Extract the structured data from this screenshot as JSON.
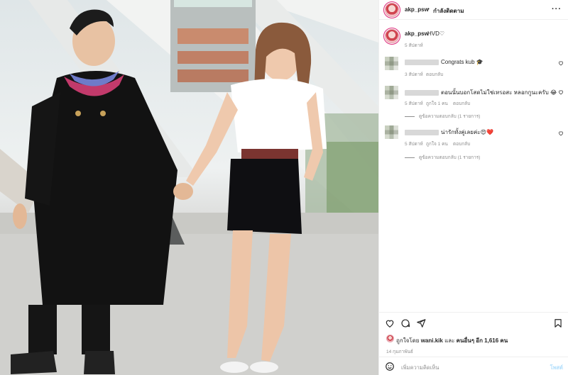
{
  "post": {
    "author": "akp_psw",
    "follow_status": "กำลังติดตาม",
    "caption": "HVD♡",
    "caption_time": "5 สัปดาห์"
  },
  "comments": [
    {
      "text": "Congrats kub 🎓",
      "time": "3 สัปดาห์",
      "reply_label": "ตอบกลับ"
    },
    {
      "text": "ตอนนั้นบอกโสดไม่ใช่เหรอสะ หลอกกูนะครับ 😂",
      "time": "5 สัปดาห์",
      "likes": "ถูกใจ 1 คน",
      "reply_label": "ตอบกลับ",
      "view_replies": "ดูข้อความตอบกลับ (1 รายการ)"
    },
    {
      "text": "น่ารักทั้งคู่เลยค่ะ😍❤️",
      "time": "5 สัปดาห์",
      "likes": "ถูกใจ 1 คน",
      "reply_label": "ตอบกลับ",
      "view_replies": "ดูข้อความตอบกลับ (1 รายการ)"
    }
  ],
  "footer": {
    "liked_by_prefix": "ถูกใจโดย",
    "liked_by_user": "wani.kik",
    "liked_by_and": "และ",
    "liked_by_others": "คนอื่นๆ อีก 1,616 คน",
    "date": "14 กุมภาพันธ์",
    "comment_placeholder": "เพิ่มความคิดเห็น",
    "post_button": "โพสต์"
  },
  "icons": {
    "more": "more-icon",
    "heart": "heart-icon",
    "comment": "comment-icon",
    "share": "share-icon",
    "bookmark": "bookmark-icon",
    "emoji": "emoji-icon"
  },
  "colors": {
    "text": "#262626",
    "muted": "#8e8e8e",
    "divider": "#efefef",
    "post_button": "#b2dffc"
  }
}
